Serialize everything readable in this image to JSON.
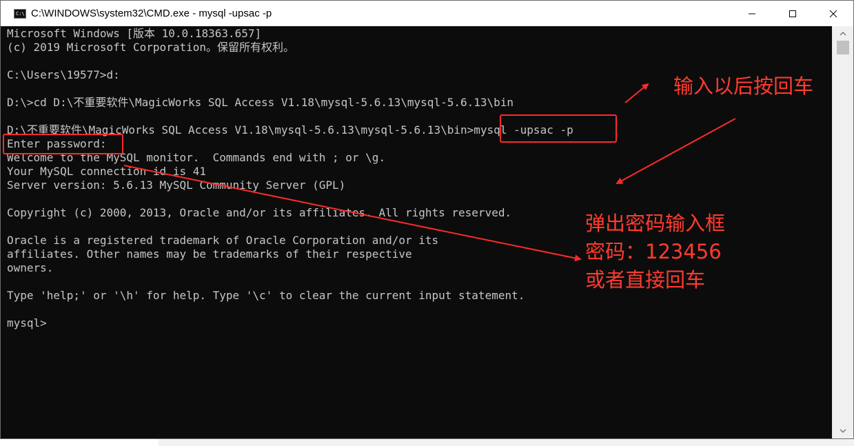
{
  "window": {
    "title": "C:\\WINDOWS\\system32\\CMD.exe - mysql  -upsac -p"
  },
  "controls": {
    "minimize": "–",
    "maximize": "☐",
    "close": "✕"
  },
  "console_lines": [
    "Microsoft Windows [版本 10.0.18363.657]",
    "(c) 2019 Microsoft Corporation。保留所有权利。",
    "",
    "C:\\Users\\19577>d:",
    "",
    "D:\\>cd D:\\不重要软件\\MagicWorks SQL Access V1.18\\mysql-5.6.13\\mysql-5.6.13\\bin",
    "",
    "D:\\不重要软件\\MagicWorks SQL Access V1.18\\mysql-5.6.13\\mysql-5.6.13\\bin>mysql -upsac -p",
    "Enter password:",
    "Welcome to the MySQL monitor.  Commands end with ; or \\g.",
    "Your MySQL connection id is 41",
    "Server version: 5.6.13 MySQL Community Server (GPL)",
    "",
    "Copyright (c) 2000, 2013, Oracle and/or its affiliates. All rights reserved.",
    "",
    "Oracle is a registered trademark of Oracle Corporation and/or its",
    "affiliates. Other names may be trademarks of their respective",
    "owners.",
    "",
    "Type 'help;' or '\\h' for help. Type '\\c' to clear the current input statement.",
    "",
    "mysql>"
  ],
  "annotations": {
    "enter_note": "输入以后按回车",
    "popup_note": "弹出密码输入框",
    "password_note": "密码：123456",
    "or_note": "或者直接回车"
  },
  "colors": {
    "console_bg": "#0c0c0c",
    "console_text": "#c6c6c6",
    "annotation_red": "#ff2a2a"
  }
}
